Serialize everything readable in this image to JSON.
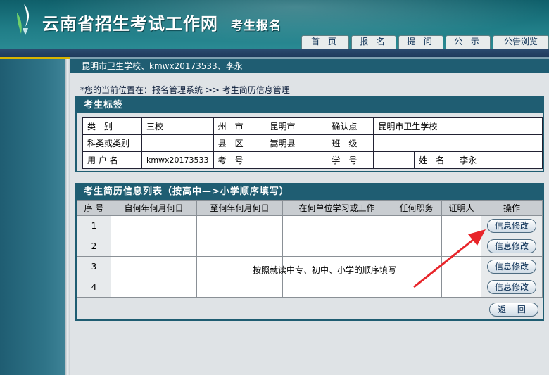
{
  "header": {
    "site_title": "云南省招生考试工作网",
    "site_subtitle": "考生报名",
    "nav": [
      "首 页",
      "报 名",
      "提 问",
      "公 示",
      "公告浏览"
    ]
  },
  "user_line": "昆明市卫生学校、kmwx20173533、李永",
  "location": "*您的当前位置在：报名管理系统 >> 考生简历信息管理",
  "tag_panel": {
    "title": "考生标签",
    "labels": {
      "category": "类　别",
      "city": "州　市",
      "confirm_point": "确认点",
      "subject": "科类或类别",
      "county": "县　区",
      "class": "班　级",
      "username": "用 户 名",
      "exam_no": "考　号",
      "student_no": "学　号",
      "name": "姓　名"
    },
    "values": {
      "category": "三校",
      "city": "昆明市",
      "confirm_point": "昆明市卫生学校",
      "subject": "",
      "county": "嵩明县",
      "class": "",
      "username": "kmwx20173533",
      "exam_no": "",
      "student_no": "",
      "name": "李永"
    }
  },
  "history_panel": {
    "title": "考生简历信息列表（按高中—>小学顺序填写）",
    "columns": [
      "序 号",
      "自何年何月何日",
      "至何年何月何日",
      "在何单位学习或工作",
      "任何职务",
      "证明人",
      "操作"
    ],
    "rows": [
      {
        "seq": "1",
        "edit_label": "信息修改"
      },
      {
        "seq": "2",
        "edit_label": "信息修改"
      },
      {
        "seq": "3",
        "edit_label": "信息修改"
      },
      {
        "seq": "4",
        "edit_label": "信息修改"
      }
    ],
    "back_label": "返 回"
  },
  "annotation": "按照就读中专、初中、小学的顺序填写",
  "colors": {
    "header_teal": "#1f7c86",
    "panel_teal": "#1f5d72",
    "arrow_red": "#e8252a"
  }
}
